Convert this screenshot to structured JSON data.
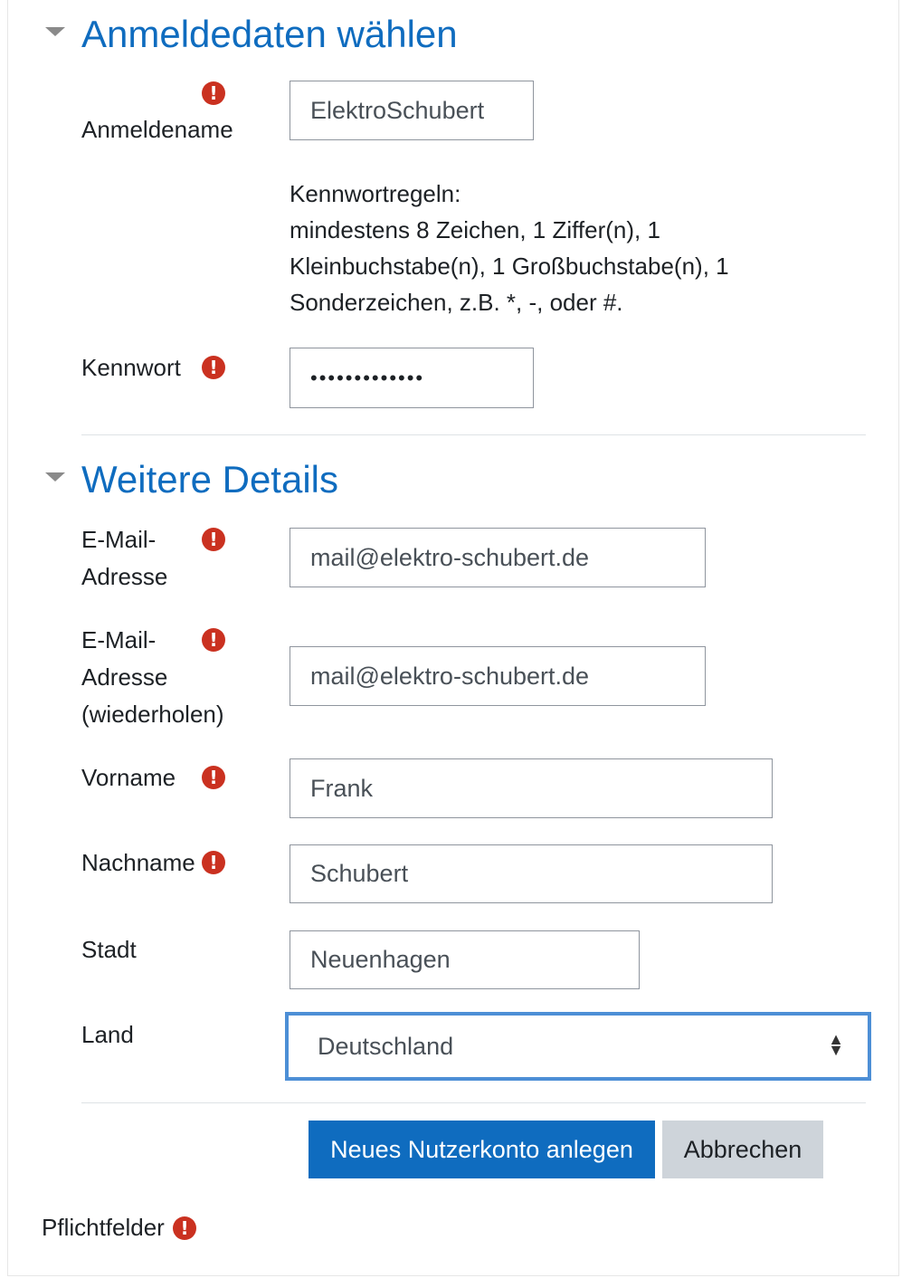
{
  "section_login": {
    "title": "Anmeldedaten wählen",
    "username_label": "Anmeldename",
    "username_value": "ElektroSchubert",
    "password_rules_title": "Kennwortregeln:",
    "password_rules_line1": "mindestens 8 Zeichen, 1 Ziffer(n), 1",
    "password_rules_line2": "Kleinbuchstabe(n), 1 Großbuchstabe(n), 1",
    "password_rules_line3": "Sonderzeichen, z.B. *, -, oder #.",
    "password_label": "Kennwort",
    "password_mask": "•••••••••••••"
  },
  "section_details": {
    "title": "Weitere Details",
    "email_label_line1": "E-Mail-",
    "email_label_line2": "Adresse",
    "email_value": "mail@elektro-schubert.de",
    "email_repeat_label_line1": "E-Mail-",
    "email_repeat_label_line2": "Adresse",
    "email_repeat_label_line3": "(wiederholen)",
    "email_repeat_value": "mail@elektro-schubert.de",
    "firstname_label": "Vorname",
    "firstname_value": "Frank",
    "lastname_label": "Nachname",
    "lastname_value": "Schubert",
    "city_label": "Stadt",
    "city_value": "Neuenhagen",
    "country_label": "Land",
    "country_value": "Deutschland"
  },
  "actions": {
    "submit_label": "Neues Nutzerkonto anlegen",
    "cancel_label": "Abbrechen"
  },
  "footer": {
    "required_label": "Pflichtfelder"
  },
  "icons": {
    "required": "!",
    "section_toggle": "caret-down-icon",
    "select_arrow": "sort-icon"
  },
  "colors": {
    "accent": "#0f6cbf",
    "required": "#ca3120",
    "focus_border": "#4d8fd6"
  }
}
